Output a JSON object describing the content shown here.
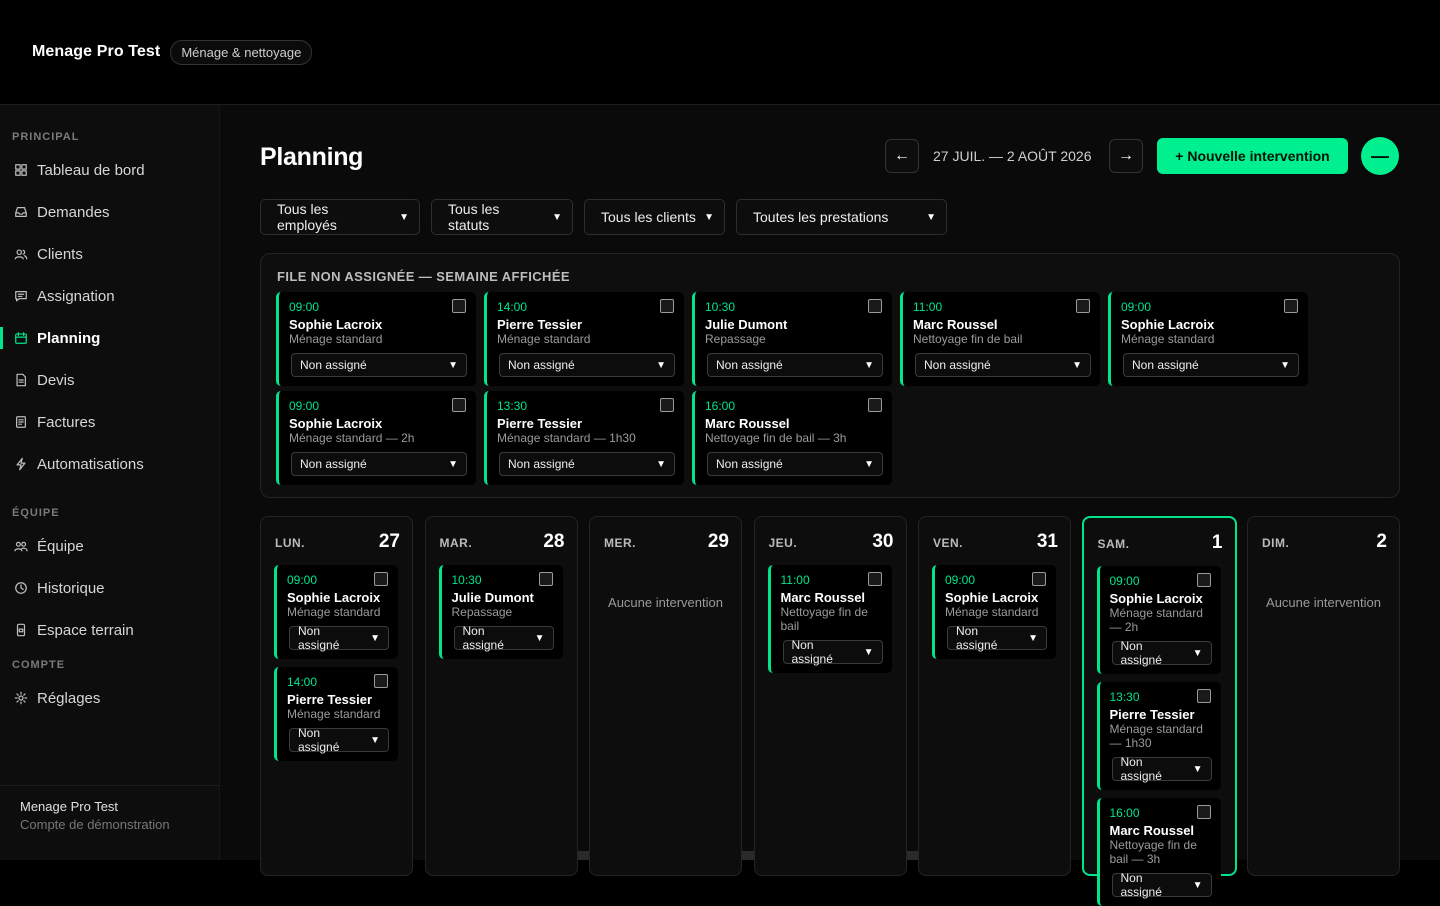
{
  "app": {
    "title": "Menage Pro Test",
    "badge": "Ménage & nettoyage"
  },
  "sidebar": {
    "sections": [
      {
        "title": "PRINCIPAL",
        "items": [
          {
            "label": "Tableau de bord",
            "icon": "grid-icon"
          },
          {
            "label": "Demandes",
            "icon": "inbox-icon"
          },
          {
            "label": "Clients",
            "icon": "users-icon"
          },
          {
            "label": "Assignation",
            "icon": "message-icon"
          },
          {
            "label": "Planning",
            "icon": "calendar-icon",
            "active": true
          },
          {
            "label": "Devis",
            "icon": "document-icon"
          },
          {
            "label": "Factures",
            "icon": "receipt-icon"
          },
          {
            "label": "Automatisations",
            "icon": "bolt-icon"
          }
        ]
      },
      {
        "title": "ÉQUIPE",
        "items": [
          {
            "label": "Équipe",
            "icon": "team-icon"
          },
          {
            "label": "Historique",
            "icon": "clock-icon"
          },
          {
            "label": "Espace terrain",
            "icon": "phone-icon"
          }
        ]
      },
      {
        "title": "COMPTE",
        "items": [
          {
            "label": "Réglages",
            "icon": "gear-icon"
          }
        ]
      }
    ],
    "footer": {
      "name": "Menage Pro Test",
      "sub": "Compte de démonstration"
    }
  },
  "header": {
    "title": "Planning",
    "prev": "←",
    "next": "→",
    "range": "27 JUIL. — 2 AOÛT 2026",
    "new_label": "+ Nouvelle intervention",
    "circle_label": "—"
  },
  "filters": [
    "Tous les employés",
    "Tous les statuts",
    "Tous les clients",
    "Toutes les prestations"
  ],
  "queue": {
    "title": "FILE NON ASSIGNÉE — SEMAINE AFFICHÉE",
    "cards": [
      {
        "time": "09:00",
        "who": "Sophie Lacroix",
        "svc": "Ménage standard",
        "assign": "Non assigné"
      },
      {
        "time": "14:00",
        "who": "Pierre Tessier",
        "svc": "Ménage standard",
        "assign": "Non assigné"
      },
      {
        "time": "10:30",
        "who": "Julie Dumont",
        "svc": "Repassage",
        "assign": "Non assigné"
      },
      {
        "time": "11:00",
        "who": "Marc Roussel",
        "svc": "Nettoyage fin de bail",
        "assign": "Non assigné"
      },
      {
        "time": "09:00",
        "who": "Sophie Lacroix",
        "svc": "Ménage standard",
        "assign": "Non assigné"
      },
      {
        "time": "09:00",
        "who": "Sophie Lacroix",
        "svc": "Ménage standard — 2h",
        "assign": "Non assigné"
      },
      {
        "time": "13:30",
        "who": "Pierre Tessier",
        "svc": "Ménage standard — 1h30",
        "assign": "Non assigné"
      },
      {
        "time": "16:00",
        "who": "Marc Roussel",
        "svc": "Nettoyage fin de bail — 3h",
        "assign": "Non assigné"
      }
    ]
  },
  "week": {
    "empty_label": "Aucune intervention",
    "days": [
      {
        "name": "LUN.",
        "date": "27",
        "cards": [
          {
            "time": "09:00",
            "who": "Sophie Lacroix",
            "svc": [
              "Ménage standard"
            ],
            "assign": "Non assigné"
          },
          {
            "time": "14:00",
            "who": "Pierre Tessier",
            "svc": [
              "Ménage standard"
            ],
            "assign": "Non assigné"
          }
        ]
      },
      {
        "name": "MAR.",
        "date": "28",
        "cards": [
          {
            "time": "10:30",
            "who": "Julie Dumont",
            "svc": [
              "Repassage"
            ],
            "assign": "Non assigné"
          }
        ]
      },
      {
        "name": "MER.",
        "date": "29",
        "cards": []
      },
      {
        "name": "JEU.",
        "date": "30",
        "cards": [
          {
            "time": "11:00",
            "who": "Marc Roussel",
            "svc": [
              "Nettoyage fin de",
              "bail"
            ],
            "assign": "Non assigné"
          }
        ]
      },
      {
        "name": "VEN.",
        "date": "31",
        "cards": [
          {
            "time": "09:00",
            "who": "Sophie Lacroix",
            "svc": [
              "Ménage standard"
            ],
            "assign": "Non assigné"
          }
        ]
      },
      {
        "name": "SAM.",
        "date": "1",
        "today": true,
        "cards": [
          {
            "time": "09:00",
            "who": "Sophie Lacroix",
            "svc": [
              "Ménage standard",
              "— 2h"
            ],
            "assign": "Non assigné"
          },
          {
            "time": "13:30",
            "who": "Pierre Tessier",
            "svc": [
              "Ménage standard",
              "— 1h30"
            ],
            "assign": "Non assigné"
          },
          {
            "time": "16:00",
            "who": "Marc Roussel",
            "svc": [
              "Nettoyage fin de",
              "bail — 3h"
            ],
            "assign": "Non assigné"
          }
        ]
      },
      {
        "name": "DIM.",
        "date": "2",
        "cards": []
      }
    ]
  },
  "colors": {
    "accent": "#00e58a",
    "button": "#00f08f",
    "bg": "#0a0a0a"
  }
}
